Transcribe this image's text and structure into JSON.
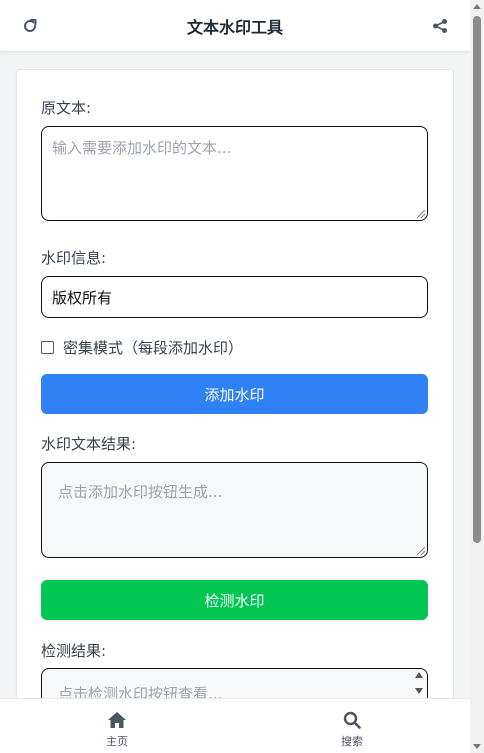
{
  "header": {
    "title": "文本水印工具",
    "left_icon": "refresh-icon",
    "right_icon": "share-icon"
  },
  "form": {
    "original_label": "原文本:",
    "original_placeholder": "输入需要添加水印的文本...",
    "watermark_label": "水印信息:",
    "watermark_value": "版权所有",
    "dense_mode_label": "密集模式（每段添加水印）",
    "add_button": "添加水印",
    "result_label": "水印文本结果:",
    "result_placeholder": "点击添加水印按钮生成...",
    "detect_button": "检测水印",
    "detect_label": "检测结果:",
    "detect_placeholder": "点击检测水印按钮查看..."
  },
  "bottom_nav": [
    {
      "label": "主页",
      "icon": "home-icon"
    },
    {
      "label": "搜索",
      "icon": "search-icon"
    }
  ],
  "colors": {
    "primary": "#3080f6",
    "success": "#00c653"
  }
}
